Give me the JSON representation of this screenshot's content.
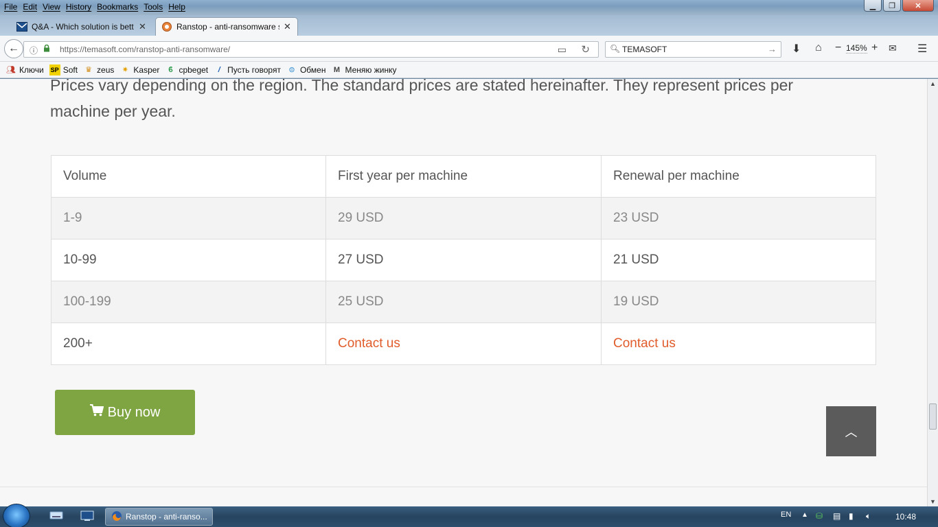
{
  "menubar": [
    "File",
    "Edit",
    "View",
    "History",
    "Bookmarks",
    "Tools",
    "Help"
  ],
  "tabs": [
    {
      "title": "Q&A - Which solution is bett",
      "icon": "mail-icon"
    },
    {
      "title": "Ranstop - anti-ransomware s",
      "icon": "temasoft-icon",
      "active": true
    }
  ],
  "navbar": {
    "url_host": "https://temasoft.com",
    "url_path": "/ranstop-anti-ransomware/",
    "search_value": "TEMASOFT",
    "zoom": "145%"
  },
  "bookmarks": [
    {
      "label": "Ключи",
      "icon": "people-icon"
    },
    {
      "label": "Soft",
      "icon": "sp-icon"
    },
    {
      "label": "zeus",
      "icon": "crown-icon"
    },
    {
      "label": "Kasper",
      "icon": "star-icon"
    },
    {
      "label": "cpbeget",
      "icon": "b-icon"
    },
    {
      "label": "Пусть говорят",
      "icon": "channel-one-icon"
    },
    {
      "label": "Обмен",
      "icon": "exchange-icon"
    },
    {
      "label": "Меняю жинку",
      "icon": "m-icon"
    }
  ],
  "page": {
    "intro": "Prices vary depending on the region. The standard prices are stated hereinafter. They represent prices per machine per year.",
    "table": {
      "headers": [
        "Volume",
        "First year per machine",
        "Renewal per machine"
      ],
      "rows": [
        [
          "1-9",
          "29 USD",
          "23 USD"
        ],
        [
          "10-99",
          "27 USD",
          "21 USD"
        ],
        [
          "100-199",
          "25 USD",
          "19 USD"
        ],
        [
          "200+",
          "Contact us",
          "Contact us"
        ]
      ]
    },
    "buy_label": "Buy now",
    "accent": "#e05c2a",
    "buy_color": "#7fa543"
  },
  "taskbar": {
    "task_title": "Ranstop - anti-ranso...",
    "lang": "EN",
    "time": "10:48"
  }
}
